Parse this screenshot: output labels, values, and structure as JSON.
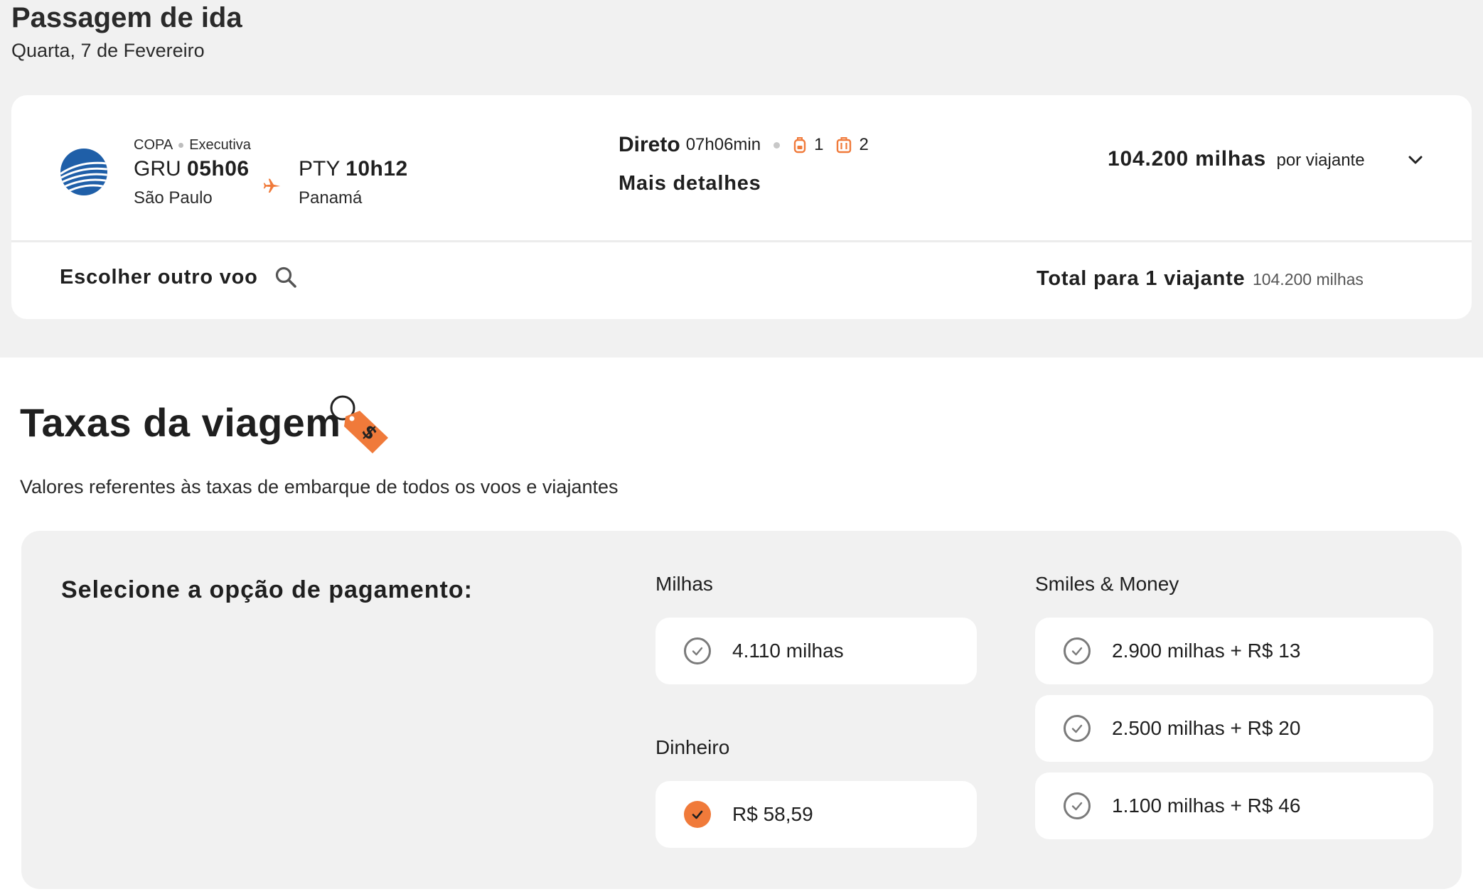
{
  "header": {
    "title": "Passagem de ida",
    "date": "Quarta, 7 de Fevereiro"
  },
  "flight": {
    "airline": "COPA",
    "cabin": "Executiva",
    "origin": {
      "code": "GRU",
      "time": "05h06",
      "city": "São Paulo"
    },
    "destination": {
      "code": "PTY",
      "time": "10h12",
      "city": "Panamá"
    },
    "stops": "Direto",
    "duration": "07h06min",
    "carry_on_count": "1",
    "checked_bags_count": "2",
    "more_details_label": "Mais detalhes",
    "price": "104.200 milhas",
    "price_unit": "por viajante",
    "choose_other_label": "Escolher outro voo",
    "total_label": "Total para 1 viajante",
    "total_value": "104.200 milhas",
    "icons": {
      "airline_logo": "copa-airline-logo",
      "plane": "plane-icon",
      "carry_on": "backpack-icon",
      "checked_bag": "suitcase-icon",
      "expand": "chevron-down-icon",
      "search": "search-icon"
    }
  },
  "fees": {
    "title": "Taxas da viagem",
    "title_icon": "price-tag-icon",
    "description": "Valores referentes às taxas de embarque de todos os voos e viajantes",
    "payment_prompt": "Selecione a opção de pagamento:",
    "groups": {
      "miles": {
        "label": "Milhas",
        "options": [
          {
            "label": "4.110 milhas",
            "selected": false
          }
        ]
      },
      "money": {
        "label": "Dinheiro",
        "options": [
          {
            "label": "R$ 58,59",
            "selected": true
          }
        ]
      },
      "smiles_money": {
        "label": "Smiles & Money",
        "options": [
          {
            "label": "2.900 milhas + R$ 13",
            "selected": false
          },
          {
            "label": "2.500 milhas + R$ 20",
            "selected": false
          },
          {
            "label": "1.100 milhas + R$ 46",
            "selected": false
          }
        ]
      }
    }
  },
  "colors": {
    "accent": "#f07a3a",
    "page_background": "#f1f1f1",
    "card_background": "#ffffff",
    "airline_blue": "#1f5fa8"
  }
}
